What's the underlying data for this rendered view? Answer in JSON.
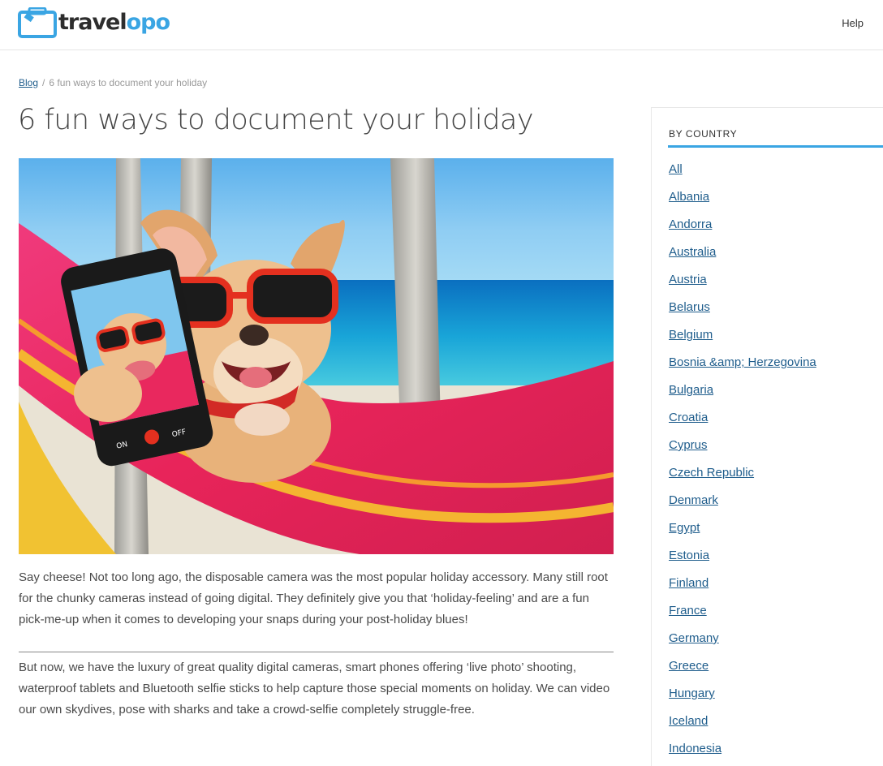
{
  "header": {
    "logo_part1": "travel",
    "logo_part2": "opo",
    "help_label": "Help"
  },
  "breadcrumb": {
    "home_label": "Blog",
    "separator": "/",
    "current": "6 fun ways to document your holiday"
  },
  "article": {
    "title": "6 fun ways to document your holiday",
    "paragraph1": "Say cheese! Not too long ago, the disposable camera was the most popular holiday accessory. Many still root for the chunky cameras instead of going digital. They definitely give you that ‘holiday-feeling’ and are a fun pick-me-up when it comes to developing your snaps during your post-holiday blues!",
    "paragraph2": "But now, we have the luxury of great quality digital cameras, smart phones offering ‘live photo’ shooting, waterproof tablets and Bluetooth selfie sticks to help capture those special moments on holiday. We can video our own skydives, pose with sharks and take a crowd-selfie completely struggle-free.",
    "phone_on_label": "ON",
    "phone_off_label": "OFF"
  },
  "sidebar": {
    "heading": "BY COUNTRY",
    "countries": [
      "All",
      "Albania",
      "Andorra",
      "Australia",
      "Austria",
      "Belarus",
      "Belgium",
      "Bosnia &amp; Herzegovina",
      "Bulgaria",
      "Croatia",
      "Cyprus",
      "Czech Republic",
      "Denmark",
      "Egypt",
      "Estonia",
      "Finland",
      "France",
      "Germany",
      "Greece",
      "Hungary",
      "Iceland",
      "Indonesia"
    ]
  },
  "colors": {
    "brand_blue": "#3aa5e3",
    "link_blue": "#1f5d8c",
    "text_gray": "#4a4a4a"
  }
}
